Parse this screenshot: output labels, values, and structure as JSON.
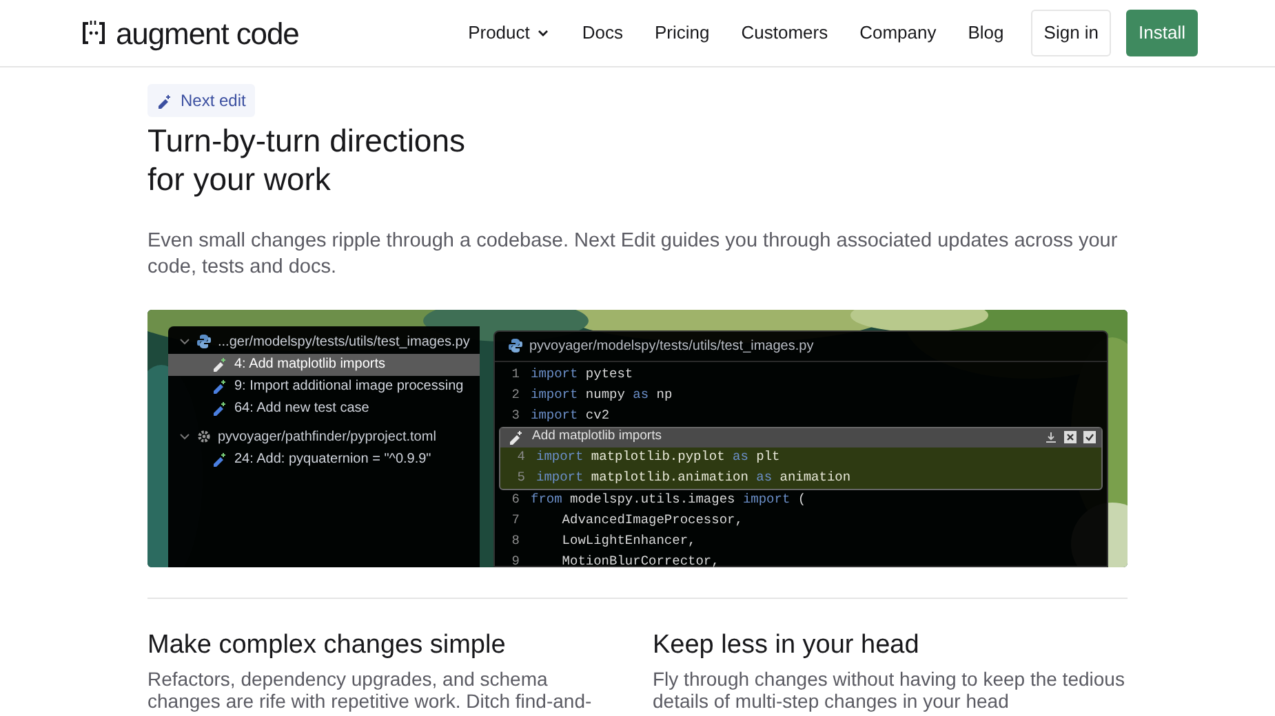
{
  "header": {
    "logo_text": "augment code",
    "nav": [
      {
        "label": "Product",
        "dropdown": true
      },
      {
        "label": "Docs",
        "dropdown": false
      },
      {
        "label": "Pricing",
        "dropdown": false
      },
      {
        "label": "Customers",
        "dropdown": false
      },
      {
        "label": "Company",
        "dropdown": false
      },
      {
        "label": "Blog",
        "dropdown": false
      }
    ],
    "sign_in": "Sign in",
    "install": "Install"
  },
  "hero": {
    "badge": "Next edit",
    "title_lines": [
      "Turn-by-turn directions",
      "for your work"
    ],
    "description": "Even small changes ripple through a codebase. Next Edit guides you through associated updates across your code, tests and docs."
  },
  "demo": {
    "tree": [
      {
        "file": "...ger/modelspy/tests/utils/test_images.py",
        "kind": "python",
        "expanded": true,
        "children": [
          {
            "label": "4: Add matplotlib imports",
            "selected": true
          },
          {
            "label": "9: Import additional image processing",
            "selected": false
          },
          {
            "label": "64: Add new test case",
            "selected": false
          }
        ]
      },
      {
        "file": "pyvoyager/pathfinder/pyproject.toml",
        "kind": "gear",
        "expanded": true,
        "children": [
          {
            "label": "24: Add: pyquaternion = \"^0.9.9\"",
            "selected": false
          }
        ]
      }
    ],
    "editor": {
      "tab": "pyvoyager/modelspy/tests/utils/test_images.py",
      "suggestion": "Add matplotlib imports",
      "lines": [
        {
          "number": "1",
          "highlighted": false,
          "tokens": [
            {
              "text": "import",
              "kind": "keyword"
            },
            {
              "text": " pytest",
              "kind": "plain"
            }
          ]
        },
        {
          "number": "2",
          "highlighted": false,
          "tokens": [
            {
              "text": "import",
              "kind": "keyword"
            },
            {
              "text": " numpy ",
              "kind": "plain"
            },
            {
              "text": "as",
              "kind": "keyword"
            },
            {
              "text": " np",
              "kind": "plain"
            }
          ]
        },
        {
          "number": "3",
          "highlighted": false,
          "tokens": [
            {
              "text": "import",
              "kind": "keyword"
            },
            {
              "text": " cv2",
              "kind": "plain"
            }
          ]
        },
        {
          "number": "4",
          "highlighted": true,
          "tokens": [
            {
              "text": "import",
              "kind": "keyword"
            },
            {
              "text": " matplotlib.pyplot ",
              "kind": "plain"
            },
            {
              "text": "as",
              "kind": "keyword"
            },
            {
              "text": " plt",
              "kind": "plain"
            }
          ]
        },
        {
          "number": "5",
          "highlighted": true,
          "tokens": [
            {
              "text": "import",
              "kind": "keyword"
            },
            {
              "text": " matplotlib.animation ",
              "kind": "plain"
            },
            {
              "text": "as",
              "kind": "keyword"
            },
            {
              "text": " animation",
              "kind": "plain"
            }
          ]
        },
        {
          "number": "6",
          "highlighted": false,
          "tokens": [
            {
              "text": "from",
              "kind": "keyword"
            },
            {
              "text": " modelspy.utils.images ",
              "kind": "plain"
            },
            {
              "text": "import",
              "kind": "keyword"
            },
            {
              "text": " (",
              "kind": "plain"
            }
          ]
        },
        {
          "number": "7",
          "highlighted": false,
          "tokens": [
            {
              "text": "    AdvancedImageProcessor,",
              "kind": "plain"
            }
          ]
        },
        {
          "number": "8",
          "highlighted": false,
          "tokens": [
            {
              "text": "    LowLightEnhancer,",
              "kind": "plain"
            }
          ]
        },
        {
          "number": "9",
          "highlighted": false,
          "tokens": [
            {
              "text": "    MotionBlurCorrector,",
              "kind": "plain"
            }
          ]
        }
      ]
    }
  },
  "features": [
    {
      "title": "Make complex changes simple",
      "text_lines": [
        "Refactors, dependency upgrades, and schema",
        "changes are rife with repetitive work. Ditch find-and-"
      ]
    },
    {
      "title": "Keep less in your head",
      "text_lines": [
        "Fly through changes without having to keep the tedious",
        "details of multi-step changes in your head"
      ]
    }
  ]
}
